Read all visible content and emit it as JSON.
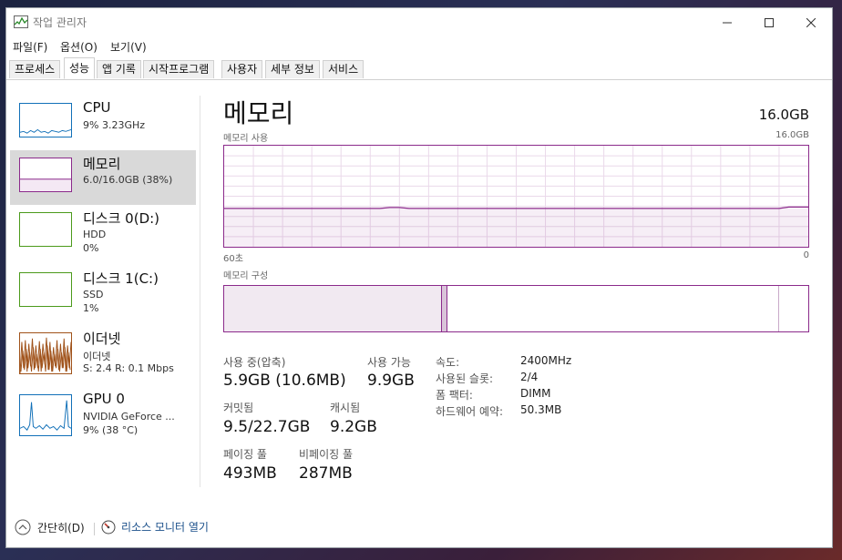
{
  "window": {
    "title": "작업 관리자"
  },
  "menu": [
    "파일(F)",
    "옵션(O)",
    "보기(V)"
  ],
  "tabs": [
    "프로세스",
    "성능",
    "앱 기록",
    "시작프로그램",
    "사용자",
    "세부 정보",
    "서비스"
  ],
  "sidebar": {
    "items": [
      {
        "title": "CPU",
        "sub1": "9% 3.23GHz",
        "sub2": ""
      },
      {
        "title": "메모리",
        "sub1": "6.0/16.0GB (38%)",
        "sub2": ""
      },
      {
        "title": "디스크 0(D:)",
        "sub1": "HDD",
        "sub2": "0%"
      },
      {
        "title": "디스크 1(C:)",
        "sub1": "SSD",
        "sub2": "1%"
      },
      {
        "title": "이더넷",
        "sub1": "이더넷",
        "sub2": "S: 2.4  R: 0.1 Mbps"
      },
      {
        "title": "GPU 0",
        "sub1": "NVIDIA GeForce ...",
        "sub2": "9% (38 °C)"
      }
    ]
  },
  "main": {
    "title": "메모리",
    "total": "16.0GB",
    "usage_label": "메모리 사용",
    "usage_max": "16.0GB",
    "time_left": "60초",
    "time_right": "0",
    "composition_label": "메모리 구성",
    "usage_level": 0.38
  },
  "stats": {
    "in_use_label": "사용 중(압축)",
    "in_use_value": "5.9GB (10.6MB)",
    "available_label": "사용 가능",
    "available_value": "9.9GB",
    "committed_label": "커밋됨",
    "committed_value": "9.5/22.7GB",
    "cached_label": "캐시됨",
    "cached_value": "9.2GB",
    "paged_label": "페이징 풀",
    "paged_value": "493MB",
    "nonpaged_label": "비페이징 풀",
    "nonpaged_value": "287MB"
  },
  "props": [
    {
      "label": "속도:",
      "value": "2400MHz"
    },
    {
      "label": "사용된 슬롯:",
      "value": "2/4"
    },
    {
      "label": "폼 팩터:",
      "value": "DIMM"
    },
    {
      "label": "하드웨어 예약:",
      "value": "50.3MB"
    }
  ],
  "footer": {
    "collapse_label": "간단히(D)",
    "resmon_label": "리소스 모니터 열기"
  },
  "colors": {
    "memory": "#8b2a8b",
    "cpu": "#1170b8",
    "disk": "#4b9a1b",
    "ethernet": "#a0521a",
    "gpu": "#1170b8"
  }
}
